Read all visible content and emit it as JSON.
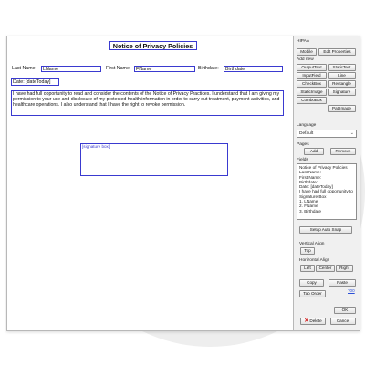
{
  "form": {
    "title": "Notice of Privacy Policies",
    "last_name_label": "Last Name:",
    "last_name_value": "LName",
    "first_name_label": "First Name:",
    "first_name_value": "FName",
    "birthdate_label": "Birthdate:",
    "birthdate_value": "Birthdate",
    "date_label": "Date: [dateToday]",
    "paragraph": "I have had full opportunity to read and consider the contents of the Notice of Privacy Practices. I understand that I am giving my permission to your use and disclosure of my protected health information in order to carry out treatment, payment activities, and healthcare operations. I also understand that I have the right to revoke permission.",
    "signature": "[signature box]"
  },
  "panel": {
    "header": "HIPAA",
    "mobile_btn": "Mobile",
    "edit_props_btn": "Edit Properties",
    "add_new_label": "Add new",
    "add_buttons": [
      "OutputText",
      "StaticText",
      "InputField",
      "Line",
      "CheckBox",
      "Rectangle",
      "StaticImage",
      "Signature",
      "ComboBox"
    ],
    "pat_image_btn": "Pat Image",
    "language_label": "Language",
    "language_value": "Default",
    "pages_label": "Pages",
    "add_btn": "Add",
    "remove_btn": "Remove",
    "fields_label": "Fields",
    "fields": [
      "Notice of Privacy Policies",
      "Last Name:",
      "First Name:",
      "Birthdate:",
      "Date: [dateToday]",
      "I have had full opportunity to",
      "Signature Box",
      "1. LName",
      "2. FName",
      "3. Birthdate"
    ],
    "setup_btn": "Setup Auto Snap",
    "vertical_align_label": "Vertical Align",
    "top_btn": "Top",
    "horizontal_align_label": "Horizontal Align",
    "left_btn": "Left",
    "center_btn": "Center",
    "right_btn": "Right",
    "copy_btn": "Copy",
    "paste_btn": "Paste",
    "tab_order_btn": "Tab Order",
    "tab_order_link": "?00",
    "ok_btn": "OK",
    "delete_btn": "Delete",
    "cancel_btn": "Cancel"
  }
}
